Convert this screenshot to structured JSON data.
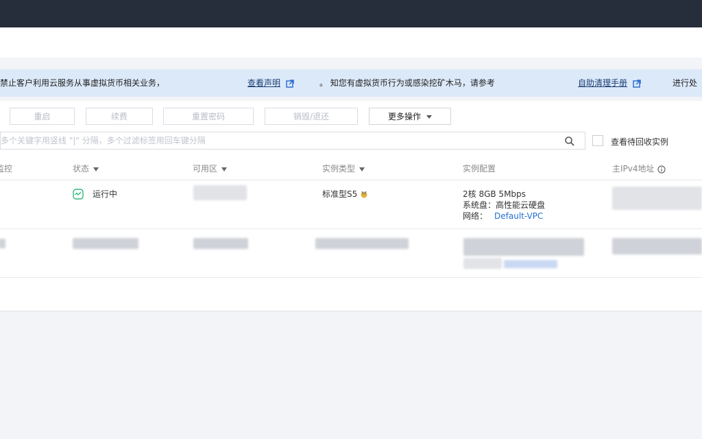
{
  "notice": {
    "text_1": "禁止客户利用云服务从事虚拟货币相关业务，",
    "link_1": "查看声明",
    "text_2": "。 知您有虚拟货币行为或感染挖矿木马，请参考",
    "link_2": "自助清理手册",
    "text_3": "进行处"
  },
  "toolbar": {
    "btn_restart": "重启",
    "btn_renew": "续费",
    "btn_reset_password": "重置密码",
    "btn_destroy": "销毁/退还",
    "btn_more": "更多操作"
  },
  "search": {
    "placeholder": "多个关键字用竖线 \"|\" 分隔，多个过滤标签用回车键分隔"
  },
  "recycle_checkbox_label": "查看待回收实例",
  "table": {
    "columns": {
      "monitor": "监控",
      "status": "状态",
      "zone": "可用区",
      "instance_type": "实例类型",
      "instance_config": "实例配置",
      "ipv4": "主IPv4地址"
    },
    "row1": {
      "status": "运行中",
      "instance_type": "标准型S5",
      "config_line1": "2核 8GB 5Mbps",
      "config_line2": "系统盘：高性能云硬盘",
      "network_label": "网络：",
      "network_value": "Default-VPC"
    }
  },
  "colors": {
    "topbar": "#262d3b",
    "notice_bg": "#dce9f9",
    "link": "#1f6fd0",
    "status_running": "#2fb57a"
  }
}
